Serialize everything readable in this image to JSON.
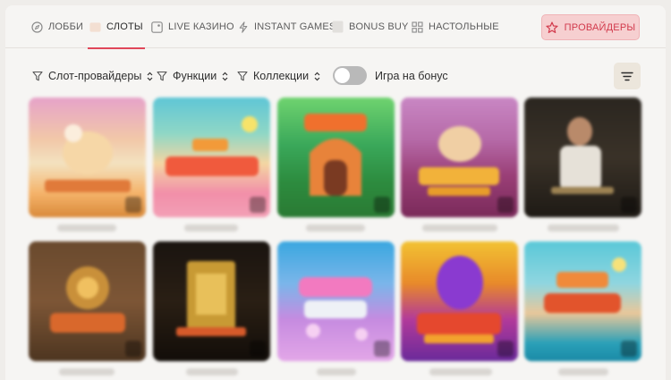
{
  "nav": {
    "tabs": [
      {
        "label": "ЛОББИ",
        "icon": "compass-icon"
      },
      {
        "label": "СЛОТЫ",
        "icon": "slots-icon",
        "active": true
      },
      {
        "label": "LIVE КАЗИНО",
        "icon": "live-casino-icon"
      },
      {
        "label": "INSTANT GAMES",
        "icon": "lightning-icon"
      },
      {
        "label": "BONUS BUY",
        "icon": "bonus-buy-icon"
      },
      {
        "label": "НАСТОЛЬНЫЕ",
        "icon": "grid-icon"
      }
    ],
    "providers_button": {
      "label": "ПРОВАЙДЕРЫ",
      "icon": "star-icon"
    }
  },
  "filters": {
    "items": [
      {
        "label": "Слот-провайдеры",
        "icon": "filter-icon"
      },
      {
        "label": "Функции",
        "icon": "filter-icon"
      },
      {
        "label": "Коллекции",
        "icon": "filter-icon"
      }
    ],
    "bonus_toggle": {
      "label": "Игра на бонус",
      "on": false
    },
    "sort_icon": "sort-lines-icon"
  },
  "colors": {
    "accent": "#e0475a",
    "providers_bg": "#f6cfd0",
    "page_bg": "#f6f5f3"
  }
}
